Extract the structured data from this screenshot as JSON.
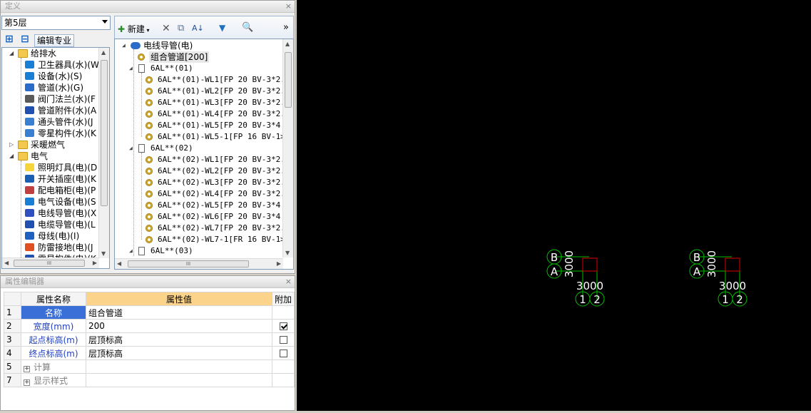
{
  "define_panel": {
    "title": "定义",
    "close": "×",
    "floor": "第5层",
    "edit_spec": "编辑专业",
    "left_tree": [
      {
        "label": "给排水",
        "level": 0,
        "type": "folder",
        "expand": "◢"
      },
      {
        "label": "卫生器具(水)(W",
        "level": 1,
        "icon": "sanitary-icon"
      },
      {
        "label": "设备(水)(S)",
        "level": 1,
        "icon": "equipment-icon"
      },
      {
        "label": "管道(水)(G)",
        "level": 1,
        "icon": "pipe-icon"
      },
      {
        "label": "阀门法兰(水)(F",
        "level": 1,
        "icon": "valve-icon"
      },
      {
        "label": "管道附件(水)(A",
        "level": 1,
        "icon": "pipe-fitting-icon"
      },
      {
        "label": "通头管件(水)(J",
        "level": 1,
        "icon": "tee-icon"
      },
      {
        "label": "零星构件(水)(K",
        "level": 1,
        "icon": "component-icon"
      },
      {
        "label": "采暖燃气",
        "level": 0,
        "type": "folder",
        "expand": "▷"
      },
      {
        "label": "电气",
        "level": 0,
        "type": "folder",
        "expand": "◢"
      },
      {
        "label": "照明灯具(电)(D",
        "level": 1,
        "icon": "bulb-icon"
      },
      {
        "label": "开关插座(电)(K",
        "level": 1,
        "icon": "switch-icon"
      },
      {
        "label": "配电箱柜(电)(P",
        "level": 1,
        "icon": "cabinet-icon"
      },
      {
        "label": "电气设备(电)(S",
        "level": 1,
        "icon": "electric-equipment-icon"
      },
      {
        "label": "电线导管(电)(X",
        "level": 1,
        "icon": "conduit-icon"
      },
      {
        "label": "电缆导管(电)(L",
        "level": 1,
        "icon": "cable-icon"
      },
      {
        "label": "母线(电)(I)",
        "level": 1,
        "icon": "busbar-icon"
      },
      {
        "label": "防雷接地(电)(J",
        "level": 1,
        "icon": "lightning-icon"
      },
      {
        "label": "零星构件(电)(K",
        "level": 1,
        "icon": "component-icon"
      }
    ],
    "toolbar": {
      "new_label": "新建",
      "delete": "✕",
      "copy": "⧉",
      "sort": "A↓",
      "filter": "▼",
      "find": "🔍",
      "more": "»"
    },
    "right_tree": {
      "root": "电线导管(电)",
      "combo": "组合管道[200]",
      "groups": [
        {
          "label": "6AL**(01)",
          "items": [
            "6AL**(01)-WL1[FP 20 BV-3*2.",
            "6AL**(01)-WL2[FP 20 BV-3*2.",
            "6AL**(01)-WL3[FP 20 BV-3*2.",
            "6AL**(01)-WL4[FP 20 BV-3*2.",
            "6AL**(01)-WL5[FP 20 BV-3*4",
            "6AL**(01)-WL5-1[FP 16 BV-1>"
          ]
        },
        {
          "label": "6AL**(02)",
          "items": [
            "6AL**(02)-WL1[FP 20 BV-3*2.",
            "6AL**(02)-WL2[FP 20 BV-3*2.",
            "6AL**(02)-WL3[FP 20 BV-3*2.",
            "6AL**(02)-WL4[FP 20 BV-3*2.",
            "6AL**(02)-WL5[FP 20 BV-3*4",
            "6AL**(02)-WL6[FP 20 BV-3*4",
            "6AL**(02)-WL7[FP 20 BV-3*2.",
            "6AL**(02)-WL7-1[FR 16 BV-1>"
          ]
        },
        {
          "label": "6AL**(03)",
          "items": []
        }
      ]
    },
    "scroll": {
      "up": "▲",
      "down": "▼",
      "left": "◀",
      "right": "▶",
      "grip": "III"
    }
  },
  "property_editor": {
    "title": "属性编辑器",
    "close": "×",
    "headers": {
      "name": "属性名称",
      "value": "属性值",
      "extra": "附加"
    },
    "rows": [
      {
        "idx": "1",
        "name": "名称",
        "value": "组合管道",
        "checkbox": "none",
        "selected": true
      },
      {
        "idx": "2",
        "name": "宽度(mm)",
        "value": "200",
        "checkbox": "checked"
      },
      {
        "idx": "3",
        "name": "起点标高(m)",
        "value": "层顶标高",
        "checkbox": "unchecked"
      },
      {
        "idx": "4",
        "name": "终点标高(m)",
        "value": "层顶标高",
        "checkbox": "unchecked"
      },
      {
        "idx": "5",
        "name": "计算",
        "value": "",
        "checkbox": "none",
        "group": true
      },
      {
        "idx": "7",
        "name": "显示样式",
        "value": "",
        "checkbox": "none",
        "group": true
      }
    ]
  },
  "canvas": {
    "grids": [
      {
        "axes_left": [
          "B",
          "A"
        ],
        "dim_vertical": "3000",
        "dim_horizontal": "3000",
        "axes_bottom": [
          "1",
          "2"
        ]
      },
      {
        "axes_left": [
          "B",
          "A"
        ],
        "dim_vertical": "3000",
        "dim_horizontal": "3000",
        "axes_bottom": [
          "1",
          "2"
        ]
      }
    ],
    "colors": {
      "grid_line": "#00c000",
      "text": "#ffffff",
      "box": "#e00000"
    }
  }
}
